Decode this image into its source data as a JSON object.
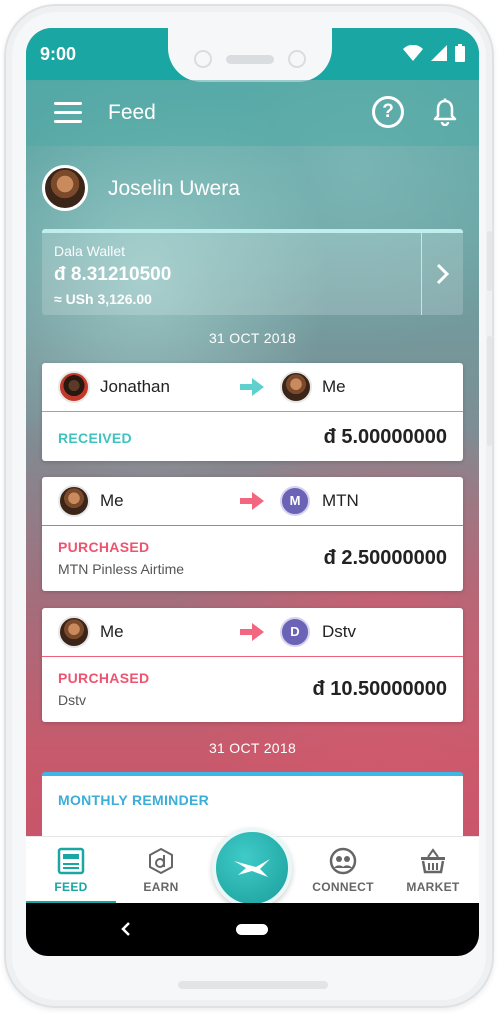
{
  "status_bar": {
    "time": "9:00"
  },
  "app_bar": {
    "title": "Feed"
  },
  "profile": {
    "name": "Joselin Uwera"
  },
  "wallet": {
    "label": "Dala Wallet",
    "balance": "đ 8.31210500",
    "fiat": "≈ USh 3,126.00"
  },
  "date_groups": [
    "31 OCT 2018",
    "31 OCT 2018"
  ],
  "transactions": [
    {
      "from": "Jonathan",
      "to": "Me",
      "status": "RECEIVED",
      "description": "",
      "amount": "đ 5.00000000",
      "accent": "#3fc3c0"
    },
    {
      "from": "Me",
      "to": "MTN",
      "to_logo": "M",
      "status": "PURCHASED",
      "description": "MTN Pinless Airtime",
      "amount": "đ 2.50000000",
      "accent": "#ee5470"
    },
    {
      "from": "Me",
      "to": "Dstv",
      "to_logo": "D",
      "status": "PURCHASED",
      "description": "Dstv",
      "amount": "đ 10.50000000",
      "accent": "#ee5470"
    }
  ],
  "reminder": {
    "label": "MONTHLY REMINDER"
  },
  "bottom_nav": {
    "items": [
      {
        "label": "FEED",
        "icon": "feed-icon",
        "active": true
      },
      {
        "label": "EARN",
        "icon": "earn-icon",
        "active": false
      },
      {
        "label": "CONNECT",
        "icon": "connect-icon",
        "active": false
      },
      {
        "label": "MARKET",
        "icon": "market-basket-icon",
        "active": false
      }
    ],
    "fab_icon": "dala-bird-icon"
  },
  "colors": {
    "brand_teal": "#1aa6a2",
    "received": "#3fc3c0",
    "purchased": "#ee5470",
    "reminder": "#3aaed8"
  }
}
